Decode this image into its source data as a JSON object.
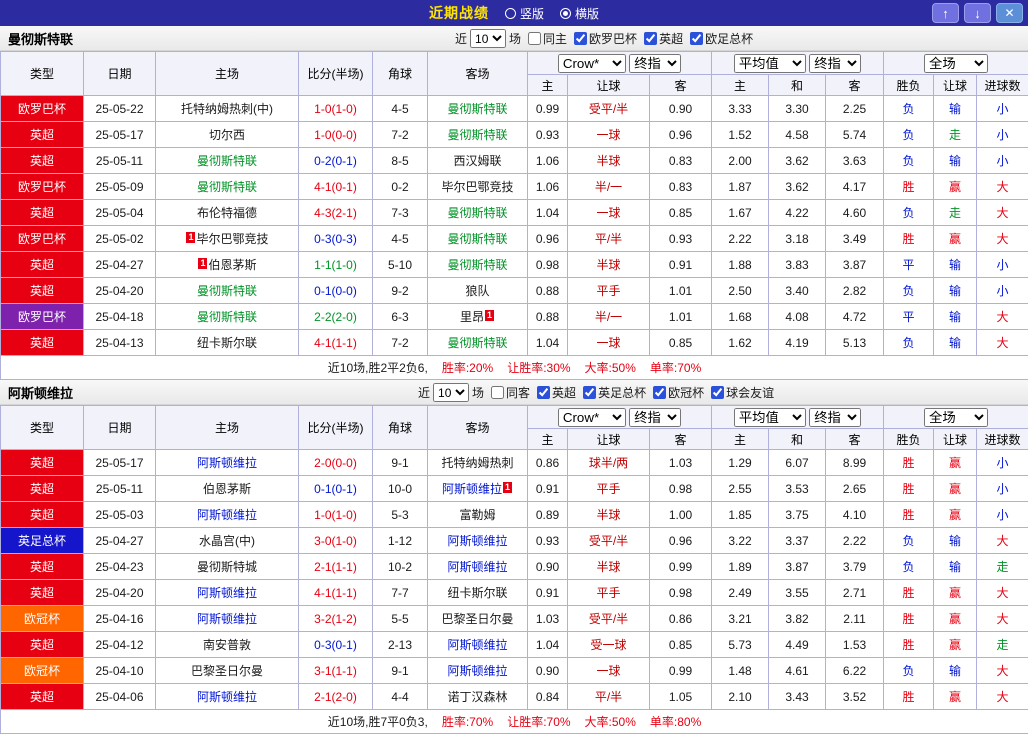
{
  "topbar": {
    "title": "近期战绩",
    "radios": [
      {
        "label": "竖版",
        "selected": false
      },
      {
        "label": "横版",
        "selected": true
      }
    ],
    "buttons": {
      "up": "↑",
      "down": "↓",
      "close": "✕"
    }
  },
  "table_header": {
    "cols": [
      "类型",
      "日期",
      "主场",
      "比分(半场)",
      "角球",
      "客场"
    ],
    "sub": [
      "主",
      "让球",
      "客",
      "主",
      "和",
      "客",
      "胜负",
      "让球",
      "进球数"
    ],
    "selects": {
      "book": "Crow*",
      "final_a": "终指",
      "avg": "平均值",
      "final_b": "终指",
      "scope": "全场"
    }
  },
  "sections": [
    {
      "team": "曼彻斯特联",
      "filter": {
        "pre": "近",
        "count": "10",
        "post": "场",
        "same": {
          "label": "同主",
          "checked": false
        },
        "leagues": [
          {
            "label": "欧罗巴杯",
            "checked": true
          },
          {
            "label": "英超",
            "checked": true
          },
          {
            "label": "欧足总杯",
            "checked": true
          }
        ]
      },
      "rows": [
        {
          "league": "欧罗巴杯",
          "bg": "#e60012",
          "date": "25-05-22",
          "home": {
            "n": "托特纳姆热刺(中)",
            "c": "black"
          },
          "score": "1-0(1-0)",
          "sc": "red",
          "corners": "4-5",
          "away": {
            "n": "曼彻斯特联",
            "c": "green"
          },
          "o1": "0.99",
          "line": "受平/半",
          "o2": "0.90",
          "a1": "3.33",
          "a2": "3.30",
          "a3": "2.25",
          "r1": "负",
          "c1": "blue",
          "r2": "输",
          "c2": "blue",
          "r3": "小",
          "c3": "blue"
        },
        {
          "league": "英超",
          "bg": "#e60012",
          "date": "25-05-17",
          "home": {
            "n": "切尔西",
            "c": "black"
          },
          "score": "1-0(0-0)",
          "sc": "red",
          "corners": "7-2",
          "away": {
            "n": "曼彻斯特联",
            "c": "green"
          },
          "o1": "0.93",
          "line": "一球",
          "o2": "0.96",
          "a1": "1.52",
          "a2": "4.58",
          "a3": "5.74",
          "r1": "负",
          "c1": "blue",
          "r2": "走",
          "c2": "green",
          "r3": "小",
          "c3": "blue"
        },
        {
          "league": "英超",
          "bg": "#e60012",
          "date": "25-05-11",
          "home": {
            "n": "曼彻斯特联",
            "c": "green"
          },
          "score": "0-2(0-1)",
          "sc": "blue",
          "corners": "8-5",
          "away": {
            "n": "西汉姆联",
            "c": "black"
          },
          "o1": "1.06",
          "line": "半球",
          "o2": "0.83",
          "a1": "2.00",
          "a2": "3.62",
          "a3": "3.63",
          "r1": "负",
          "c1": "blue",
          "r2": "输",
          "c2": "blue",
          "r3": "小",
          "c3": "blue"
        },
        {
          "league": "欧罗巴杯",
          "bg": "#e60012",
          "date": "25-05-09",
          "home": {
            "n": "曼彻斯特联",
            "c": "green"
          },
          "score": "4-1(0-1)",
          "sc": "red",
          "corners": "0-2",
          "away": {
            "n": "毕尔巴鄂竞技",
            "c": "black"
          },
          "o1": "1.06",
          "line": "半/一",
          "o2": "0.83",
          "a1": "1.87",
          "a2": "3.62",
          "a3": "4.17",
          "r1": "胜",
          "c1": "red",
          "r2": "赢",
          "c2": "red",
          "r3": "大",
          "c3": "red"
        },
        {
          "league": "英超",
          "bg": "#e60012",
          "date": "25-05-04",
          "home": {
            "n": "布伦特福德",
            "c": "black"
          },
          "score": "4-3(2-1)",
          "sc": "red",
          "corners": "7-3",
          "away": {
            "n": "曼彻斯特联",
            "c": "green"
          },
          "o1": "1.04",
          "line": "一球",
          "o2": "0.85",
          "a1": "1.67",
          "a2": "4.22",
          "a3": "4.60",
          "r1": "负",
          "c1": "blue",
          "r2": "走",
          "c2": "green",
          "r3": "大",
          "c3": "red"
        },
        {
          "league": "欧罗巴杯",
          "bg": "#e60012",
          "date": "25-05-02",
          "home": {
            "n": "毕尔巴鄂竞技",
            "c": "black",
            "card": "L"
          },
          "score": "0-3(0-3)",
          "sc": "blue",
          "corners": "4-5",
          "away": {
            "n": "曼彻斯特联",
            "c": "green"
          },
          "o1": "0.96",
          "line": "平/半",
          "o2": "0.93",
          "a1": "2.22",
          "a2": "3.18",
          "a3": "3.49",
          "r1": "胜",
          "c1": "red",
          "r2": "赢",
          "c2": "red",
          "r3": "大",
          "c3": "red"
        },
        {
          "league": "英超",
          "bg": "#e60012",
          "date": "25-04-27",
          "home": {
            "n": "伯恩茅斯",
            "c": "black",
            "card": "L"
          },
          "score": "1-1(1-0)",
          "sc": "green",
          "corners": "5-10",
          "away": {
            "n": "曼彻斯特联",
            "c": "green"
          },
          "o1": "0.98",
          "line": "半球",
          "o2": "0.91",
          "a1": "1.88",
          "a2": "3.83",
          "a3": "3.87",
          "r1": "平",
          "c1": "blue",
          "r2": "输",
          "c2": "blue",
          "r3": "小",
          "c3": "blue"
        },
        {
          "league": "英超",
          "bg": "#e60012",
          "date": "25-04-20",
          "home": {
            "n": "曼彻斯特联",
            "c": "green"
          },
          "score": "0-1(0-0)",
          "sc": "blue",
          "corners": "9-2",
          "away": {
            "n": "狼队",
            "c": "black"
          },
          "o1": "0.88",
          "line": "平手",
          "o2": "1.01",
          "a1": "2.50",
          "a2": "3.40",
          "a3": "2.82",
          "r1": "负",
          "c1": "blue",
          "r2": "输",
          "c2": "blue",
          "r3": "小",
          "c3": "blue"
        },
        {
          "league": "欧罗巴杯",
          "bg": "#7e22ad",
          "date": "25-04-18",
          "home": {
            "n": "曼彻斯特联",
            "c": "green"
          },
          "score": "2-2(2-0)",
          "sc": "green",
          "corners": "6-3",
          "away": {
            "n": "里昂",
            "c": "black",
            "card": "R"
          },
          "o1": "0.88",
          "line": "半/一",
          "o2": "1.01",
          "a1": "1.68",
          "a2": "4.08",
          "a3": "4.72",
          "r1": "平",
          "c1": "blue",
          "r2": "输",
          "c2": "blue",
          "r3": "大",
          "c3": "red"
        },
        {
          "league": "英超",
          "bg": "#e60012",
          "date": "25-04-13",
          "home": {
            "n": "纽卡斯尔联",
            "c": "black"
          },
          "score": "4-1(1-1)",
          "sc": "red",
          "corners": "7-2",
          "away": {
            "n": "曼彻斯特联",
            "c": "green"
          },
          "o1": "1.04",
          "line": "一球",
          "o2": "0.85",
          "a1": "1.62",
          "a2": "4.19",
          "a3": "5.13",
          "r1": "负",
          "c1": "blue",
          "r2": "输",
          "c2": "blue",
          "r3": "大",
          "c3": "red"
        }
      ],
      "summary": {
        "record": "近10场,胜2平2负6,",
        "stats": [
          {
            "label": "胜率:",
            "value": "20%"
          },
          {
            "label": "让胜率:",
            "value": "30%"
          },
          {
            "label": "大率:",
            "value": "50%"
          },
          {
            "label": "单率:",
            "value": "70%"
          }
        ]
      }
    },
    {
      "team": "阿斯顿维拉",
      "filter": {
        "pre": "近",
        "count": "10",
        "post": "场",
        "same": {
          "label": "同客",
          "checked": false
        },
        "leagues": [
          {
            "label": "英超",
            "checked": true
          },
          {
            "label": "英足总杯",
            "checked": true
          },
          {
            "label": "欧冠杯",
            "checked": true
          },
          {
            "label": "球会友谊",
            "checked": true
          }
        ]
      },
      "rows": [
        {
          "league": "英超",
          "bg": "#e60012",
          "date": "25-05-17",
          "home": {
            "n": "阿斯顿维拉",
            "c": "blue"
          },
          "score": "2-0(0-0)",
          "sc": "red",
          "corners": "9-1",
          "away": {
            "n": "托特纳姆热刺",
            "c": "black"
          },
          "o1": "0.86",
          "line": "球半/两",
          "o2": "1.03",
          "a1": "1.29",
          "a2": "6.07",
          "a3": "8.99",
          "r1": "胜",
          "c1": "red",
          "r2": "赢",
          "c2": "red",
          "r3": "小",
          "c3": "blue"
        },
        {
          "league": "英超",
          "bg": "#e60012",
          "date": "25-05-11",
          "home": {
            "n": "伯恩茅斯",
            "c": "black"
          },
          "score": "0-1(0-1)",
          "sc": "blue",
          "corners": "10-0",
          "away": {
            "n": "阿斯顿维拉",
            "c": "blue",
            "card": "R"
          },
          "o1": "0.91",
          "line": "平手",
          "o2": "0.98",
          "a1": "2.55",
          "a2": "3.53",
          "a3": "2.65",
          "r1": "胜",
          "c1": "red",
          "r2": "赢",
          "c2": "red",
          "r3": "小",
          "c3": "blue"
        },
        {
          "league": "英超",
          "bg": "#e60012",
          "date": "25-05-03",
          "home": {
            "n": "阿斯顿维拉",
            "c": "blue"
          },
          "score": "1-0(1-0)",
          "sc": "red",
          "corners": "5-3",
          "away": {
            "n": "富勒姆",
            "c": "black"
          },
          "o1": "0.89",
          "line": "半球",
          "o2": "1.00",
          "a1": "1.85",
          "a2": "3.75",
          "a3": "4.10",
          "r1": "胜",
          "c1": "red",
          "r2": "赢",
          "c2": "red",
          "r3": "小",
          "c3": "blue"
        },
        {
          "league": "英足总杯",
          "bg": "#1515cc",
          "date": "25-04-27",
          "home": {
            "n": "水晶宫(中)",
            "c": "black"
          },
          "score": "3-0(1-0)",
          "sc": "red",
          "corners": "1-12",
          "away": {
            "n": "阿斯顿维拉",
            "c": "blue"
          },
          "o1": "0.93",
          "line": "受平/半",
          "o2": "0.96",
          "a1": "3.22",
          "a2": "3.37",
          "a3": "2.22",
          "r1": "负",
          "c1": "blue",
          "r2": "输",
          "c2": "blue",
          "r3": "大",
          "c3": "red"
        },
        {
          "league": "英超",
          "bg": "#e60012",
          "date": "25-04-23",
          "home": {
            "n": "曼彻斯特城",
            "c": "black"
          },
          "score": "2-1(1-1)",
          "sc": "red",
          "corners": "10-2",
          "away": {
            "n": "阿斯顿维拉",
            "c": "blue"
          },
          "o1": "0.90",
          "line": "半球",
          "o2": "0.99",
          "a1": "1.89",
          "a2": "3.87",
          "a3": "3.79",
          "r1": "负",
          "c1": "blue",
          "r2": "输",
          "c2": "blue",
          "r3": "走",
          "c3": "green"
        },
        {
          "league": "英超",
          "bg": "#e60012",
          "date": "25-04-20",
          "home": {
            "n": "阿斯顿维拉",
            "c": "blue"
          },
          "score": "4-1(1-1)",
          "sc": "red",
          "corners": "7-7",
          "away": {
            "n": "纽卡斯尔联",
            "c": "black"
          },
          "o1": "0.91",
          "line": "平手",
          "o2": "0.98",
          "a1": "2.49",
          "a2": "3.55",
          "a3": "2.71",
          "r1": "胜",
          "c1": "red",
          "r2": "赢",
          "c2": "red",
          "r3": "大",
          "c3": "red"
        },
        {
          "league": "欧冠杯",
          "bg": "#ff6600",
          "date": "25-04-16",
          "home": {
            "n": "阿斯顿维拉",
            "c": "blue"
          },
          "score": "3-2(1-2)",
          "sc": "red",
          "corners": "5-5",
          "away": {
            "n": "巴黎圣日尔曼",
            "c": "black"
          },
          "o1": "1.03",
          "line": "受平/半",
          "o2": "0.86",
          "a1": "3.21",
          "a2": "3.82",
          "a3": "2.11",
          "r1": "胜",
          "c1": "red",
          "r2": "赢",
          "c2": "red",
          "r3": "大",
          "c3": "red"
        },
        {
          "league": "英超",
          "bg": "#e60012",
          "date": "25-04-12",
          "home": {
            "n": "南安普敦",
            "c": "black"
          },
          "score": "0-3(0-1)",
          "sc": "blue",
          "corners": "2-13",
          "away": {
            "n": "阿斯顿维拉",
            "c": "blue"
          },
          "o1": "1.04",
          "line": "受一球",
          "o2": "0.85",
          "a1": "5.73",
          "a2": "4.49",
          "a3": "1.53",
          "r1": "胜",
          "c1": "red",
          "r2": "赢",
          "c2": "red",
          "r3": "走",
          "c3": "green"
        },
        {
          "league": "欧冠杯",
          "bg": "#ff6600",
          "date": "25-04-10",
          "home": {
            "n": "巴黎圣日尔曼",
            "c": "black"
          },
          "score": "3-1(1-1)",
          "sc": "red",
          "corners": "9-1",
          "away": {
            "n": "阿斯顿维拉",
            "c": "blue"
          },
          "o1": "0.90",
          "line": "一球",
          "o2": "0.99",
          "a1": "1.48",
          "a2": "4.61",
          "a3": "6.22",
          "r1": "负",
          "c1": "blue",
          "r2": "输",
          "c2": "blue",
          "r3": "大",
          "c3": "red"
        },
        {
          "league": "英超",
          "bg": "#e60012",
          "date": "25-04-06",
          "home": {
            "n": "阿斯顿维拉",
            "c": "blue"
          },
          "score": "2-1(2-0)",
          "sc": "red",
          "corners": "4-4",
          "away": {
            "n": "诺丁汉森林",
            "c": "black"
          },
          "o1": "0.84",
          "line": "平/半",
          "o2": "1.05",
          "a1": "2.10",
          "a2": "3.43",
          "a3": "3.52",
          "r1": "胜",
          "c1": "red",
          "r2": "赢",
          "c2": "red",
          "r3": "大",
          "c3": "red"
        }
      ],
      "summary": {
        "record": "近10场,胜7平0负3,",
        "stats": [
          {
            "label": "胜率:",
            "value": "70%"
          },
          {
            "label": "让胜率:",
            "value": "70%"
          },
          {
            "label": "大率:",
            "value": "50%"
          },
          {
            "label": "单率:",
            "value": "80%"
          }
        ]
      }
    }
  ]
}
